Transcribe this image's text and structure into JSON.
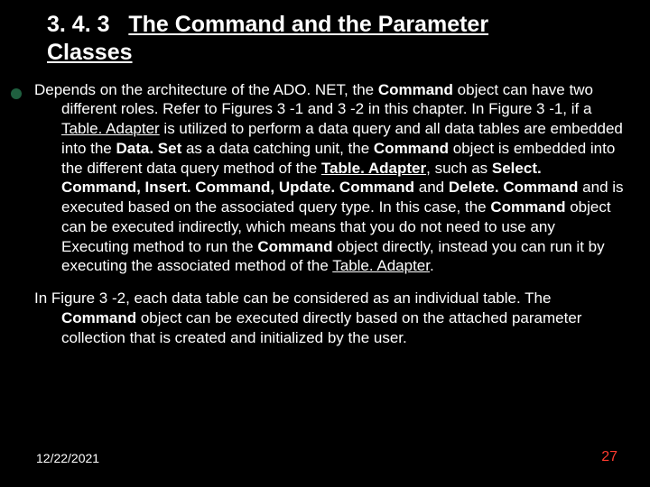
{
  "heading": {
    "num": "3. 4. 3",
    "title_u": "The Command and the Parameter Classes"
  },
  "para1": {
    "t0": "Depends on the architecture of the ADO. NET, the ",
    "cmd1": "Command",
    "t1": " object can have two different roles. Refer to Figures 3 -1 and 3 -2 in this chapter. In Figure 3 -1, if  a ",
    "ta1": "Table. Adapter",
    "t2": " is utilized to perform a data query and all data tables are embedded into the ",
    "dset": "Data. Set",
    "t3": " as a data catching unit, the ",
    "cmd2": "Command",
    "t4": " object is embedded into the different data query method of the ",
    "ta2": "Table. Adapter",
    "t5": ", such as ",
    "sc": "Select. Command, Insert. Command, Update. Command",
    "t6": " and ",
    "dc": "Delete. Command",
    "t7": " and is executed based on the associated query type. In this case, the ",
    "cmd3": "Command",
    "t8": " object can be executed indirectly, which means that you do not need to use any Executing method to run the ",
    "cmd4": "Command",
    "t9": " object directly, instead you can run it by executing the associated method of the ",
    "ta3": "Table. Adapter",
    "t10": ". "
  },
  "para2": {
    "t0": " In Figure 3 -2, each data table can be considered as an individual table. The ",
    "cmd": "Command",
    "t1": " object can be executed directly based on the attached parameter collection that is created and initialized by the user. "
  },
  "footer": {
    "date": "12/22/2021",
    "page": "27"
  }
}
